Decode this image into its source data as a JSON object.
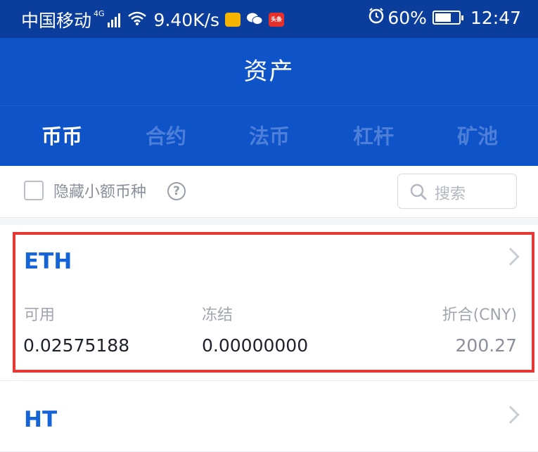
{
  "status_bar": {
    "carrier": "中国移动",
    "network": "4G",
    "speed": "9.40K/s",
    "battery": "60%",
    "time": "12:47",
    "news_badge": "头条"
  },
  "header": {
    "title": "资产"
  },
  "tabs": [
    {
      "label": "币币",
      "active": true
    },
    {
      "label": "合约",
      "active": false
    },
    {
      "label": "法币",
      "active": false
    },
    {
      "label": "杠杆",
      "active": false
    },
    {
      "label": "矿池",
      "active": false
    }
  ],
  "filter": {
    "hide_small_label": "隐藏小额币种",
    "search_placeholder": "搜索"
  },
  "assets": [
    {
      "coin": "ETH",
      "available_label": "可用",
      "available": "0.02575188",
      "frozen_label": "冻结",
      "frozen": "0.00000000",
      "cny_label": "折合(CNY)",
      "cny": "200.27"
    },
    {
      "coin": "HT"
    }
  ],
  "colors": {
    "primary": "#0f53c8",
    "statusbar": "#0a3d9c",
    "coin_text": "#1464d8",
    "highlight": "#e53935"
  },
  "icons": [
    "alarm-icon",
    "wifi-icon",
    "signal-icon",
    "battery-icon",
    "search-icon",
    "help-icon",
    "chevron-right-icon"
  ]
}
